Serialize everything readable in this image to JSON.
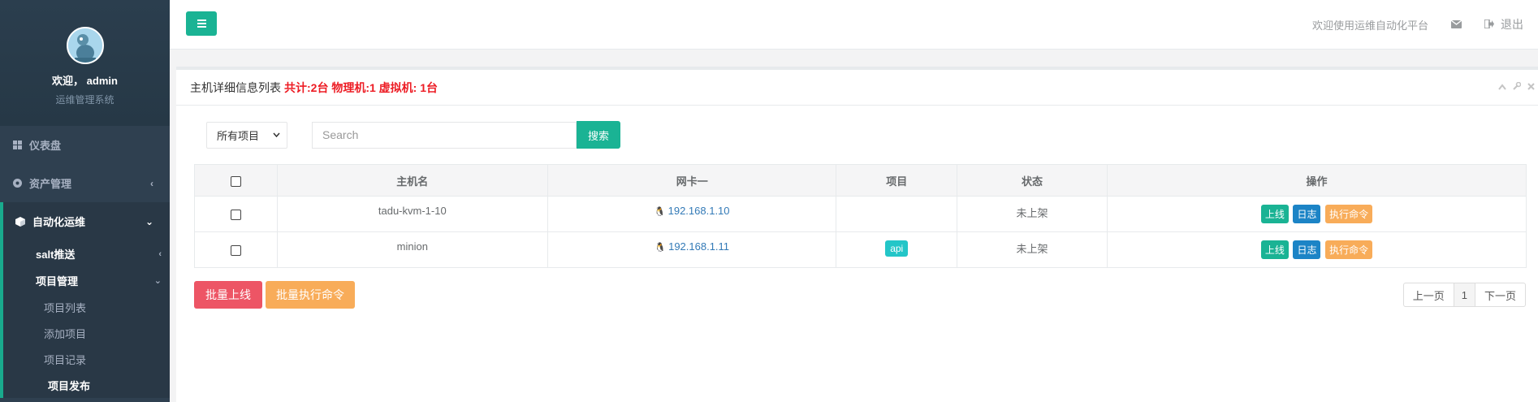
{
  "sidebar": {
    "welcome": "欢迎， admin",
    "role": "运维管理系统",
    "items": [
      {
        "label": "仪表盘"
      },
      {
        "label": "资产管理"
      },
      {
        "label": "自动化运维"
      }
    ],
    "sub_items": [
      {
        "label": "salt推送"
      },
      {
        "label": "项目管理"
      }
    ],
    "subsub_items": [
      {
        "label": "项目列表"
      },
      {
        "label": "添加项目"
      },
      {
        "label": "项目记录"
      },
      {
        "label": "项目发布"
      }
    ]
  },
  "header": {
    "welcome": "欢迎使用运维自动化平台",
    "logout": "退出"
  },
  "panel": {
    "title": "主机详细信息列表",
    "stats": "共计:2台 物理机:1 虚拟机: 1台"
  },
  "filter": {
    "select_value": "所有项目",
    "search_placeholder": "Search",
    "search_button": "搜索"
  },
  "table": {
    "columns": [
      "主机名",
      "网卡一",
      "项目",
      "状态",
      "操作"
    ],
    "rows": [
      {
        "hostname": "tadu-kvm-1-10",
        "ip": "192.168.1.10",
        "project": "",
        "status": "未上架"
      },
      {
        "hostname": "minion",
        "ip": "192.168.1.11",
        "project": "api",
        "status": "未上架"
      }
    ],
    "actions": {
      "online": "上线",
      "log": "日志",
      "exec": "执行命令"
    }
  },
  "bulk": {
    "online": "批量上线",
    "exec": "批量执行命令"
  },
  "pager": {
    "prev": "上一页",
    "current": "1",
    "next": "下一页"
  },
  "colors": {
    "primary": "#1ab394",
    "danger": "#ed5565",
    "warning": "#f8ac59",
    "info": "#23c6c8",
    "success": "#1c84c6",
    "sidebar": "#2f4050",
    "stats_red": "#ed1c24"
  }
}
